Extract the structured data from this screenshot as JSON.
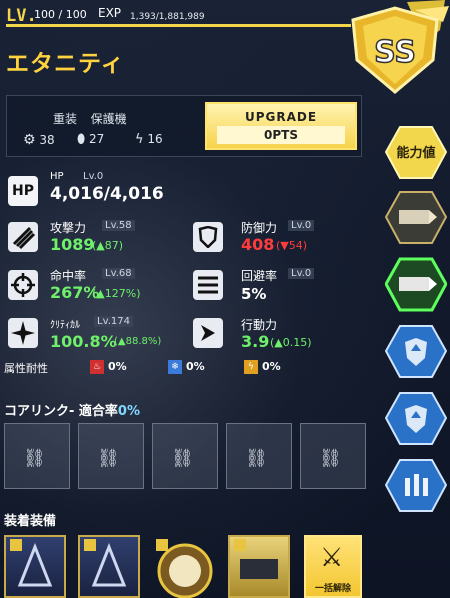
{
  "header": {
    "lv_tag": "LV.",
    "lv_value": "100 / 100",
    "exp_label": "EXP",
    "exp_value": "1,393/1,881,989",
    "unit_name": "エタニティ",
    "level_progress": 1.0
  },
  "info": {
    "class_armor": "重装",
    "class_role": "保護機",
    "stat1": "38",
    "stat2": "27",
    "stat3": "16",
    "upgrade_label": "UPGRADE",
    "upgrade_pts": "0PTS"
  },
  "sidebar": {
    "ability_label": "能力値",
    "buttons": [
      "missile-icon",
      "missile-icon-selected",
      "shield-up-icon",
      "shield-up-icon-2",
      "bullets-icon"
    ]
  },
  "stats": {
    "hp": {
      "icon": "HP",
      "label": "HP",
      "lv": "Lv.0",
      "value": "4,016/4,016"
    },
    "attack": {
      "label": "攻撃力",
      "lv": "Lv.58",
      "value": "1089",
      "bonus": "(▲87)"
    },
    "defense": {
      "label": "防御力",
      "lv": "Lv.0",
      "value": "408",
      "bonus": "(▼54)"
    },
    "accuracy": {
      "label": "命中率",
      "lv": "Lv.68",
      "value": "267%",
      "bonus": "(▲127%)"
    },
    "evasion": {
      "label": "回避率",
      "lv": "Lv.0",
      "value": "5%"
    },
    "critical": {
      "label": "ｸﾘﾃｨｶﾙ",
      "lv": "Lv.174",
      "value": "100.8%",
      "bonus": "(▲88.8%)"
    },
    "action": {
      "label": "行動力",
      "value": "3.9",
      "bonus": "(▲0.15)"
    }
  },
  "resistance": {
    "label": "属性耐性",
    "fire": "0%",
    "ice": "0%",
    "electric": "0%"
  },
  "core_link": {
    "title": "コアリンク- 適合率",
    "rate": "0%"
  },
  "equipment": {
    "title": "装着装備",
    "release_label": "一括解除"
  },
  "colors": {
    "gold": "#f2d64b",
    "green": "#6ef06a",
    "red": "#ff3b3b",
    "button_yellow": "#f6d24c"
  }
}
